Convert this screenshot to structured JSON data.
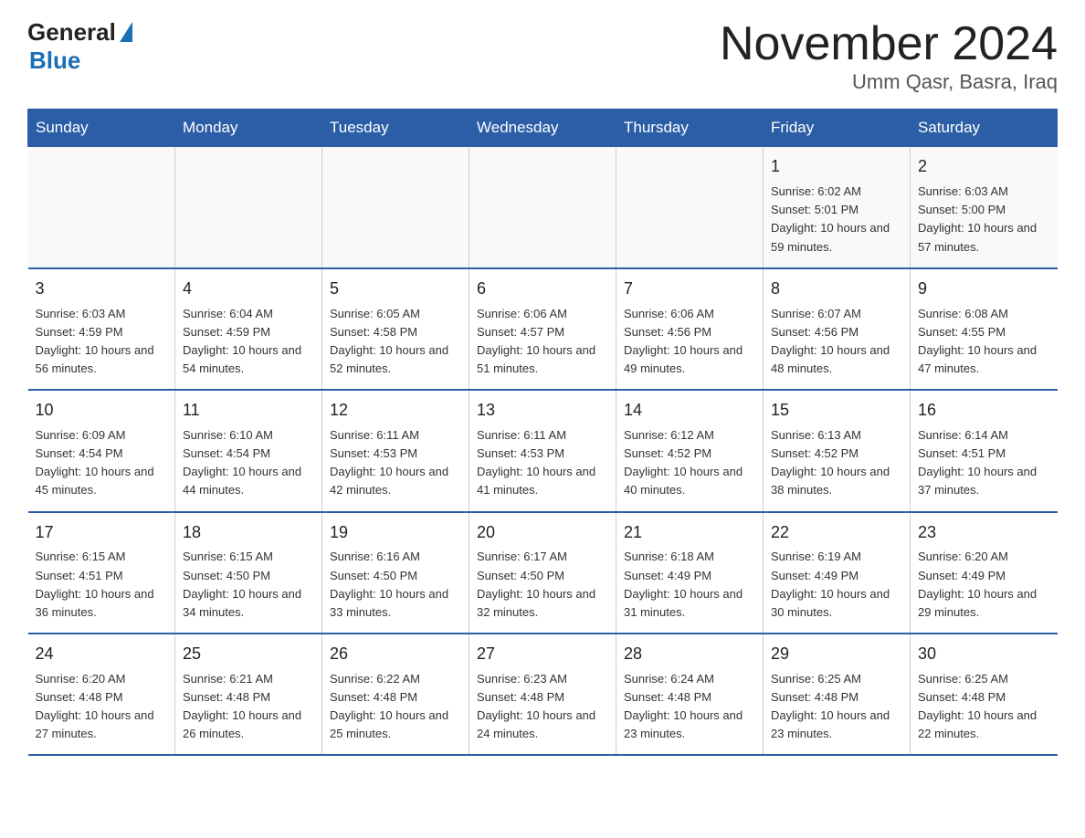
{
  "header": {
    "logo_general": "General",
    "logo_blue": "Blue",
    "title": "November 2024",
    "subtitle": "Umm Qasr, Basra, Iraq"
  },
  "weekdays": [
    "Sunday",
    "Monday",
    "Tuesday",
    "Wednesday",
    "Thursday",
    "Friday",
    "Saturday"
  ],
  "weeks": [
    [
      {
        "day": "",
        "info": ""
      },
      {
        "day": "",
        "info": ""
      },
      {
        "day": "",
        "info": ""
      },
      {
        "day": "",
        "info": ""
      },
      {
        "day": "",
        "info": ""
      },
      {
        "day": "1",
        "info": "Sunrise: 6:02 AM\nSunset: 5:01 PM\nDaylight: 10 hours and 59 minutes."
      },
      {
        "day": "2",
        "info": "Sunrise: 6:03 AM\nSunset: 5:00 PM\nDaylight: 10 hours and 57 minutes."
      }
    ],
    [
      {
        "day": "3",
        "info": "Sunrise: 6:03 AM\nSunset: 4:59 PM\nDaylight: 10 hours and 56 minutes."
      },
      {
        "day": "4",
        "info": "Sunrise: 6:04 AM\nSunset: 4:59 PM\nDaylight: 10 hours and 54 minutes."
      },
      {
        "day": "5",
        "info": "Sunrise: 6:05 AM\nSunset: 4:58 PM\nDaylight: 10 hours and 52 minutes."
      },
      {
        "day": "6",
        "info": "Sunrise: 6:06 AM\nSunset: 4:57 PM\nDaylight: 10 hours and 51 minutes."
      },
      {
        "day": "7",
        "info": "Sunrise: 6:06 AM\nSunset: 4:56 PM\nDaylight: 10 hours and 49 minutes."
      },
      {
        "day": "8",
        "info": "Sunrise: 6:07 AM\nSunset: 4:56 PM\nDaylight: 10 hours and 48 minutes."
      },
      {
        "day": "9",
        "info": "Sunrise: 6:08 AM\nSunset: 4:55 PM\nDaylight: 10 hours and 47 minutes."
      }
    ],
    [
      {
        "day": "10",
        "info": "Sunrise: 6:09 AM\nSunset: 4:54 PM\nDaylight: 10 hours and 45 minutes."
      },
      {
        "day": "11",
        "info": "Sunrise: 6:10 AM\nSunset: 4:54 PM\nDaylight: 10 hours and 44 minutes."
      },
      {
        "day": "12",
        "info": "Sunrise: 6:11 AM\nSunset: 4:53 PM\nDaylight: 10 hours and 42 minutes."
      },
      {
        "day": "13",
        "info": "Sunrise: 6:11 AM\nSunset: 4:53 PM\nDaylight: 10 hours and 41 minutes."
      },
      {
        "day": "14",
        "info": "Sunrise: 6:12 AM\nSunset: 4:52 PM\nDaylight: 10 hours and 40 minutes."
      },
      {
        "day": "15",
        "info": "Sunrise: 6:13 AM\nSunset: 4:52 PM\nDaylight: 10 hours and 38 minutes."
      },
      {
        "day": "16",
        "info": "Sunrise: 6:14 AM\nSunset: 4:51 PM\nDaylight: 10 hours and 37 minutes."
      }
    ],
    [
      {
        "day": "17",
        "info": "Sunrise: 6:15 AM\nSunset: 4:51 PM\nDaylight: 10 hours and 36 minutes."
      },
      {
        "day": "18",
        "info": "Sunrise: 6:15 AM\nSunset: 4:50 PM\nDaylight: 10 hours and 34 minutes."
      },
      {
        "day": "19",
        "info": "Sunrise: 6:16 AM\nSunset: 4:50 PM\nDaylight: 10 hours and 33 minutes."
      },
      {
        "day": "20",
        "info": "Sunrise: 6:17 AM\nSunset: 4:50 PM\nDaylight: 10 hours and 32 minutes."
      },
      {
        "day": "21",
        "info": "Sunrise: 6:18 AM\nSunset: 4:49 PM\nDaylight: 10 hours and 31 minutes."
      },
      {
        "day": "22",
        "info": "Sunrise: 6:19 AM\nSunset: 4:49 PM\nDaylight: 10 hours and 30 minutes."
      },
      {
        "day": "23",
        "info": "Sunrise: 6:20 AM\nSunset: 4:49 PM\nDaylight: 10 hours and 29 minutes."
      }
    ],
    [
      {
        "day": "24",
        "info": "Sunrise: 6:20 AM\nSunset: 4:48 PM\nDaylight: 10 hours and 27 minutes."
      },
      {
        "day": "25",
        "info": "Sunrise: 6:21 AM\nSunset: 4:48 PM\nDaylight: 10 hours and 26 minutes."
      },
      {
        "day": "26",
        "info": "Sunrise: 6:22 AM\nSunset: 4:48 PM\nDaylight: 10 hours and 25 minutes."
      },
      {
        "day": "27",
        "info": "Sunrise: 6:23 AM\nSunset: 4:48 PM\nDaylight: 10 hours and 24 minutes."
      },
      {
        "day": "28",
        "info": "Sunrise: 6:24 AM\nSunset: 4:48 PM\nDaylight: 10 hours and 23 minutes."
      },
      {
        "day": "29",
        "info": "Sunrise: 6:25 AM\nSunset: 4:48 PM\nDaylight: 10 hours and 23 minutes."
      },
      {
        "day": "30",
        "info": "Sunrise: 6:25 AM\nSunset: 4:48 PM\nDaylight: 10 hours and 22 minutes."
      }
    ]
  ]
}
